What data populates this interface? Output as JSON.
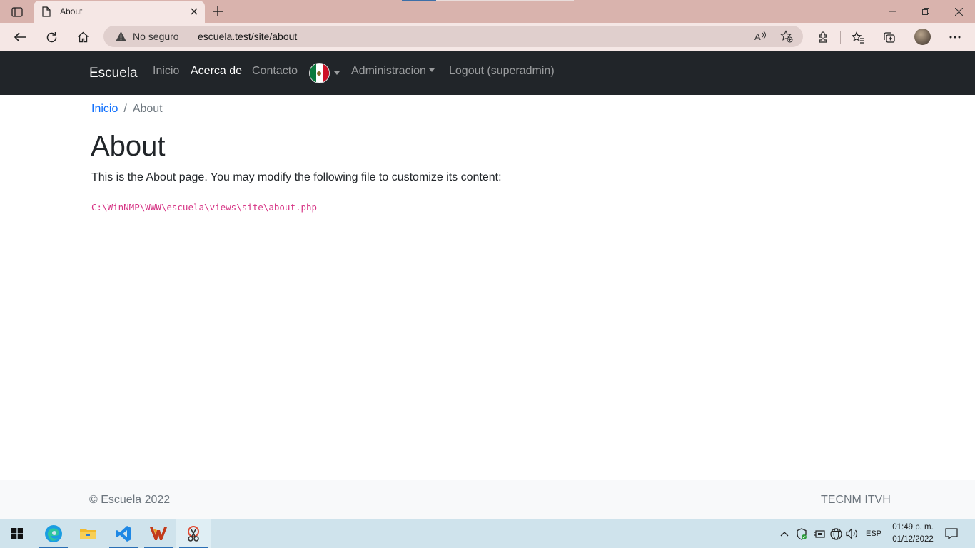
{
  "browser": {
    "tab_title": "About",
    "security_label": "No seguro",
    "url": "escuela.test/site/about"
  },
  "navbar": {
    "brand": "Escuela",
    "links": [
      "Inicio",
      "Acerca de",
      "Contacto"
    ],
    "admin_label": "Administracion",
    "logout_label": "Logout (superadmin)"
  },
  "breadcrumb": {
    "home": "Inicio",
    "separator": "/",
    "current": "About"
  },
  "page": {
    "title": "About",
    "description": "This is the About page. You may modify the following file to customize its content:",
    "code": "C:\\WinNMP\\WWW\\escuela\\views\\site\\about.php"
  },
  "footer": {
    "left": "© Escuela 2022",
    "right": "TECNM ITVH"
  },
  "taskbar": {
    "language": "ESP",
    "time": "01:49 p. m.",
    "date": "01/12/2022"
  },
  "colors": {
    "navbar_bg": "#212529",
    "link_blue": "#0d6efd",
    "code_pink": "#d63384",
    "tabstrip_bg": "#d9b3ad"
  }
}
